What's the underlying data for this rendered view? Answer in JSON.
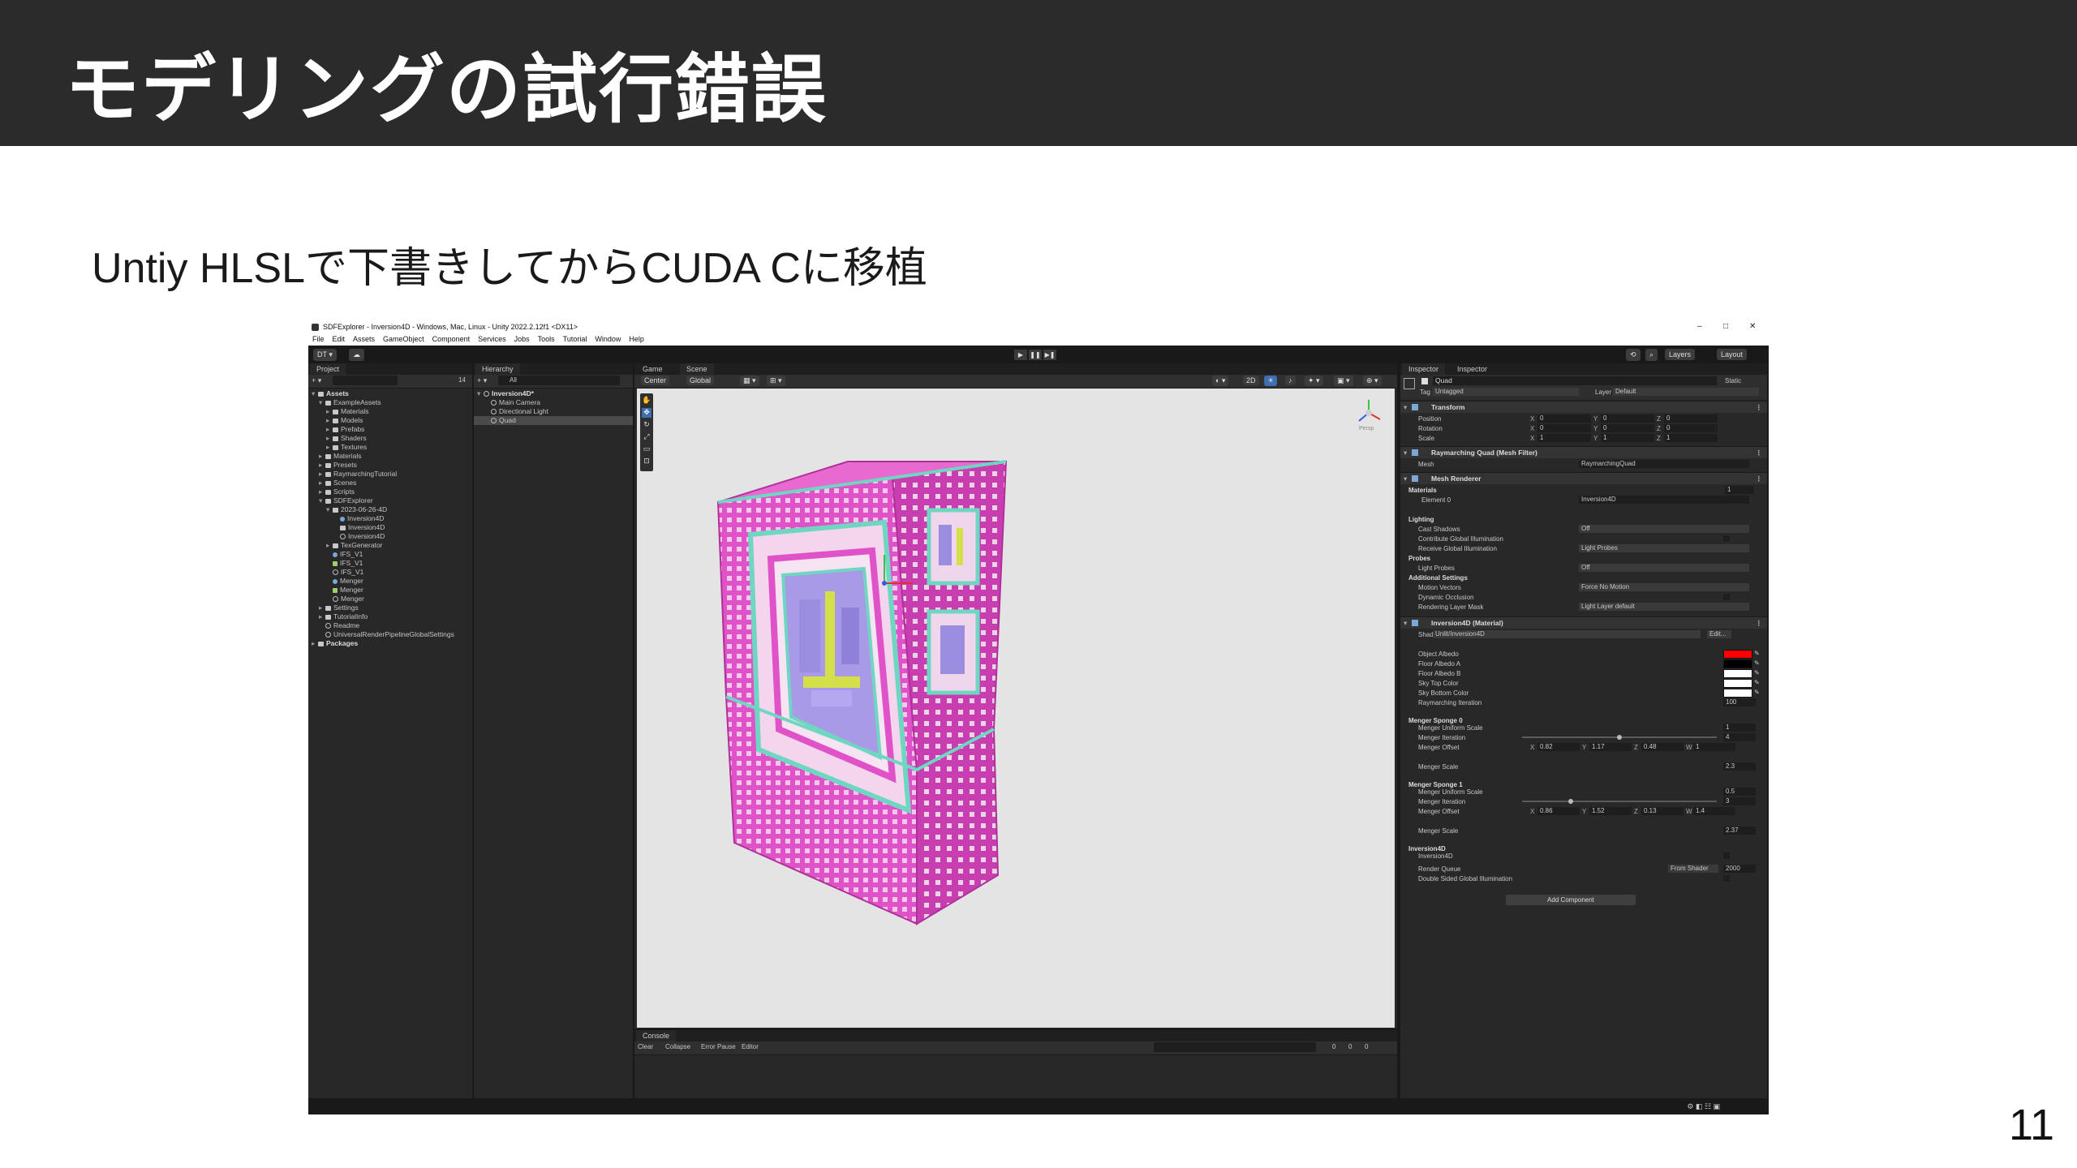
{
  "slide": {
    "title": "モデリングの試行錯誤",
    "subtitle": "Untiy HLSLで下書きしてからCUDA Cに移植",
    "page_number": "11"
  },
  "colors": {
    "header_bg": "#2b2b2b",
    "fractal_pink": "#e052c8",
    "fractal_teal": "#6fd6c2",
    "fractal_purple": "#9b8de0",
    "fractal_yellow": "#d4e04a",
    "object_albedo": "#ff0000"
  },
  "unity": {
    "window_title": "SDFExplorer - Inversion4D - Windows, Mac, Linux - Unity 2022.2.12f1 <DX11>",
    "window_controls": [
      "–",
      "□",
      "✕"
    ],
    "menu": [
      "File",
      "Edit",
      "Assets",
      "GameObject",
      "Component",
      "Services",
      "Jobs",
      "Tools",
      "Tutorial",
      "Window",
      "Help"
    ],
    "toolbar": {
      "account": "DT ▾",
      "layers": "Layers",
      "layout": "Layout",
      "play": "▶",
      "pause": "❚❚",
      "step": "▶❚"
    },
    "project": {
      "tab": "Project",
      "count": "14",
      "items": [
        {
          "label": "Assets",
          "depth": 0,
          "bold": true,
          "fold": "▾",
          "icon": "folder"
        },
        {
          "label": "ExampleAssets",
          "depth": 1,
          "fold": "▾",
          "icon": "folder"
        },
        {
          "label": "Materials",
          "depth": 2,
          "fold": "▸",
          "icon": "folder"
        },
        {
          "label": "Models",
          "depth": 2,
          "fold": "▸",
          "icon": "folder"
        },
        {
          "label": "Prefabs",
          "depth": 2,
          "fold": "▸",
          "icon": "folder"
        },
        {
          "label": "Shaders",
          "depth": 2,
          "fold": "▸",
          "icon": "folder"
        },
        {
          "label": "Textures",
          "depth": 2,
          "fold": "▸",
          "icon": "folder"
        },
        {
          "label": "Materials",
          "depth": 1,
          "fold": "▸",
          "icon": "folder"
        },
        {
          "label": "Presets",
          "depth": 1,
          "fold": "▸",
          "icon": "folder"
        },
        {
          "label": "RaymarchingTutorial",
          "depth": 1,
          "fold": "▸",
          "icon": "folder"
        },
        {
          "label": "Scenes",
          "depth": 1,
          "fold": "▸",
          "icon": "folder"
        },
        {
          "label": "Scripts",
          "depth": 1,
          "fold": "▸",
          "icon": "folder"
        },
        {
          "label": "SDFExplorer",
          "depth": 1,
          "fold": "▾",
          "icon": "folder"
        },
        {
          "label": "2023-06-26-4D",
          "depth": 2,
          "fold": "▾",
          "icon": "folder"
        },
        {
          "label": "Inversion4D",
          "depth": 3,
          "icon": "mat"
        },
        {
          "label": "Inversion4D",
          "depth": 3,
          "icon": "file"
        },
        {
          "label": "Inversion4D",
          "depth": 3,
          "icon": "go"
        },
        {
          "label": "TexGenerator",
          "depth": 2,
          "fold": "▸",
          "icon": "folder"
        },
        {
          "label": "IFS_V1",
          "depth": 2,
          "icon": "mat"
        },
        {
          "label": "IFS_V1",
          "depth": 2,
          "icon": "sh"
        },
        {
          "label": "IFS_V1",
          "depth": 2,
          "icon": "go"
        },
        {
          "label": "Menger",
          "depth": 2,
          "icon": "mat"
        },
        {
          "label": "Menger",
          "depth": 2,
          "icon": "sh"
        },
        {
          "label": "Menger",
          "depth": 2,
          "icon": "go"
        },
        {
          "label": "Settings",
          "depth": 1,
          "fold": "▸",
          "icon": "folder"
        },
        {
          "label": "TutorialInfo",
          "depth": 1,
          "fold": "▸",
          "icon": "folder"
        },
        {
          "label": "Readme",
          "depth": 1,
          "icon": "go"
        },
        {
          "label": "UniversalRenderPipelineGlobalSettings",
          "depth": 1,
          "icon": "go"
        },
        {
          "label": "Packages",
          "depth": 0,
          "bold": true,
          "fold": "▸",
          "icon": "folder"
        }
      ]
    },
    "hierarchy": {
      "tab": "Hierarchy",
      "search_prefix": "All",
      "items": [
        {
          "label": "Inversion4D*",
          "depth": 0,
          "bold": true,
          "fold": "▾",
          "icon": "go"
        },
        {
          "label": "Main Camera",
          "depth": 1,
          "icon": "go"
        },
        {
          "label": "Directional Light",
          "depth": 1,
          "icon": "go"
        },
        {
          "label": "Quad",
          "depth": 1,
          "icon": "go",
          "selected": true
        }
      ]
    },
    "scene": {
      "tabs": [
        "Game",
        "Scene"
      ],
      "center_label": "Center",
      "global_label": "Global",
      "persp_label": "Persp",
      "gizmo_2d": "2D"
    },
    "console": {
      "tab": "Console",
      "buttons": [
        "Clear",
        "Collapse",
        "Error Pause",
        "Editor"
      ],
      "counts": [
        "0",
        "0",
        "0"
      ]
    },
    "inspector": {
      "tabs": [
        "Inspector",
        "Inspector"
      ],
      "object_name": "Quad",
      "static_label": "Static",
      "tag_label": "Tag",
      "tag_value": "Untagged",
      "layer_label": "Layer",
      "layer_value": "Default",
      "transform": {
        "title": "Transform",
        "rows": [
          {
            "label": "Position",
            "x": "0",
            "y": "0",
            "z": "0"
          },
          {
            "label": "Rotation",
            "x": "0",
            "y": "0",
            "z": "0"
          },
          {
            "label": "Scale",
            "x": "1",
            "y": "1",
            "z": "1"
          }
        ]
      },
      "mesh_filter": {
        "title": "Raymarching Quad (Mesh Filter)",
        "mesh_label": "Mesh",
        "mesh_value": "RaymarchingQuad"
      },
      "mesh_renderer": {
        "title": "Mesh Renderer",
        "materials_label": "Materials",
        "materials_count": "1",
        "element_label": "Element 0",
        "element_value": "Inversion4D",
        "lighting_label": "Lighting",
        "cast_shadows_label": "Cast Shadows",
        "cast_shadows_value": "Off",
        "contribute_gi_label": "Contribute Global Illumination",
        "receive_gi_label": "Receive Global Illumination",
        "receive_gi_value": "Light Probes",
        "probes_label": "Probes",
        "light_probes_label": "Light Probes",
        "light_probes_value": "Off",
        "additional_label": "Additional Settings",
        "motion_vectors_label": "Motion Vectors",
        "motion_vectors_value": "Force No Motion",
        "dynamic_occlusion_label": "Dynamic Occlusion",
        "rendering_layer_label": "Rendering Layer Mask",
        "rendering_layer_value": "Light Layer default"
      },
      "material": {
        "title": "Inversion4D (Material)",
        "shader_label": "Shader",
        "shader_value": "Unlit/Inversion4D",
        "edit_label": "Edit...",
        "props": [
          {
            "label": "Object Albedo",
            "type": "color",
            "color": "#ff0000"
          },
          {
            "label": "Floor Albedo A",
            "type": "color",
            "color": "#000000"
          },
          {
            "label": "Floor Albedo B",
            "type": "color",
            "color": "#ffffff"
          },
          {
            "label": "Sky Top Color",
            "type": "color",
            "color": "#ffffff"
          },
          {
            "label": "Sky Bottom Color",
            "type": "color",
            "color": "#ffffff"
          },
          {
            "label": "Raymarching Iteration",
            "type": "value",
            "value": "100"
          }
        ],
        "sponge0": {
          "heading": "Menger Sponge 0",
          "uniform_label": "Menger Uniform Scale",
          "uniform_value": "1",
          "iteration_label": "Menger Iteration",
          "iteration_value": "4",
          "iteration_slider": 0.5,
          "offset_label": "Menger Offset",
          "offset_x": "0.82",
          "offset_y": "1.17",
          "offset_z": "0.48",
          "offset_w": "1",
          "scale_label": "Menger Scale",
          "scale_value": "2.3"
        },
        "sponge1": {
          "heading": "Menger Sponge 1",
          "uniform_label": "Menger Uniform Scale",
          "uniform_value": "0.5",
          "iteration_label": "Menger Iteration",
          "iteration_value": "3",
          "iteration_slider": 0.25,
          "offset_label": "Menger Offset",
          "offset_x": "0.86",
          "offset_y": "1.52",
          "offset_z": "0.13",
          "offset_w": "1.4",
          "scale_label": "Menger Scale",
          "scale_value": "2.37"
        },
        "inversion_heading": "Inversion4D",
        "inversion_sub": "Inversion4D",
        "render_queue_label": "Render Queue",
        "render_queue_mode": "From Shader",
        "render_queue_value": "2000",
        "double_sided_label": "Double Sided Global Illumination"
      },
      "add_component": "Add Component"
    }
  }
}
